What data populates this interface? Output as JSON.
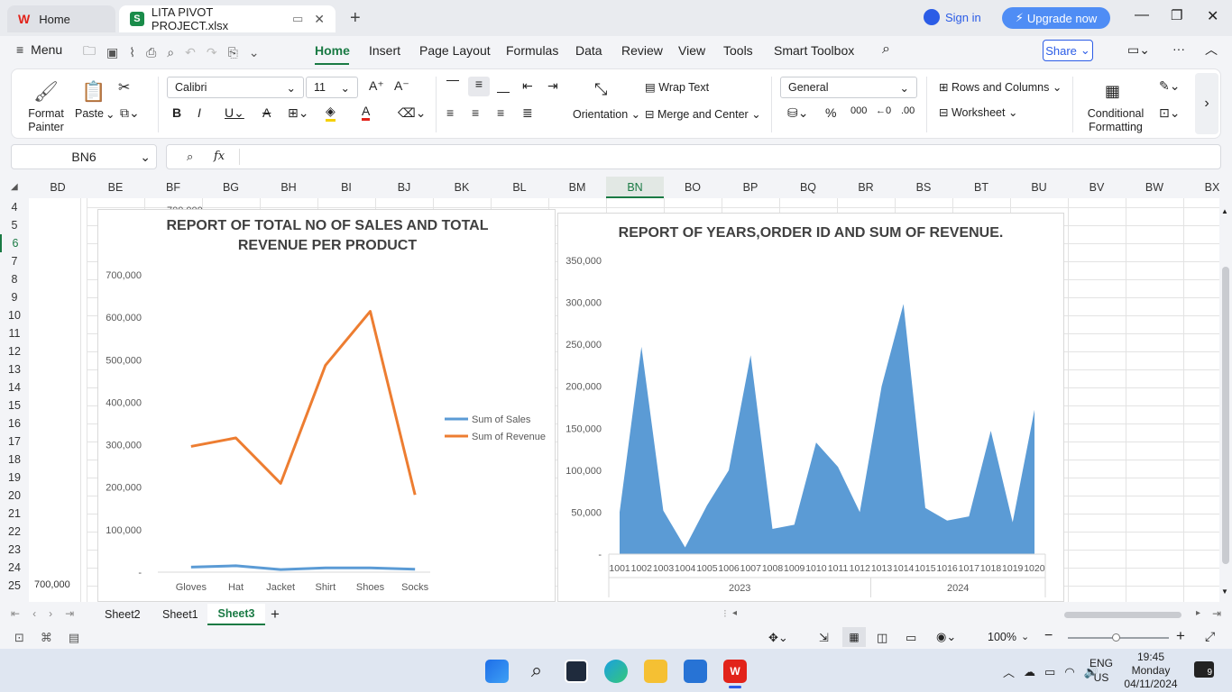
{
  "titlebar": {
    "home_tab": "Home",
    "file_tab": "LITA PIVOT PROJECT.xlsx",
    "sign_in": "Sign in",
    "upgrade": "Upgrade now"
  },
  "menubar": {
    "menu": "Menu",
    "tabs": [
      "Home",
      "Insert",
      "Page Layout",
      "Formulas",
      "Data",
      "Review",
      "View",
      "Tools",
      "Smart Toolbox"
    ],
    "share": "Share"
  },
  "ribbon": {
    "format_painter": "Format Painter",
    "paste": "Paste",
    "font": "Calibri",
    "size": "11",
    "wrap_text": "Wrap Text",
    "merge_center": "Merge and Center",
    "orientation": "Orientation",
    "number_format": "General",
    "rows_columns": "Rows and Columns",
    "worksheet": "Worksheet",
    "conditional_formatting": "Conditional Formatting"
  },
  "formula_bar": {
    "cell_ref": "BN6",
    "fx": "fx",
    "value": ""
  },
  "columns": [
    "BD",
    "BE",
    "BF",
    "BG",
    "BH",
    "BI",
    "BJ",
    "BK",
    "BL",
    "BM",
    "BN",
    "BO",
    "BP",
    "BQ",
    "BR",
    "BS",
    "BT",
    "BU",
    "BV",
    "BW",
    "BX"
  ],
  "selected_column": "BN",
  "rows": [
    "4",
    "5",
    "6",
    "7",
    "8",
    "9",
    "10",
    "11",
    "12",
    "13",
    "14",
    "15",
    "16",
    "17",
    "18",
    "19",
    "20",
    "21",
    "22",
    "23",
    "24",
    "25"
  ],
  "selected_row": "6",
  "cell_bd25": "700,000",
  "cell_bf4": "700,000",
  "chart_data": [
    {
      "type": "line",
      "title": "REPORT OF TOTAL NO OF SALES AND TOTAL REVENUE PER PRODUCT",
      "categories": [
        "Gloves",
        "Hat",
        "Jacket",
        "Shirt",
        "Shoes",
        "Socks"
      ],
      "ylim": [
        0,
        700000
      ],
      "yticks": [
        "700,000",
        "600,000",
        "500,000",
        "400,000",
        "300,000",
        "200,000",
        "100,000",
        "-"
      ],
      "series": [
        {
          "name": "Sum of Sales",
          "color": "#5b9bd5",
          "values": [
            12000,
            15000,
            6000,
            10000,
            10000,
            7000
          ]
        },
        {
          "name": "Sum of Revenue",
          "color": "#ed7d31",
          "values": [
            296000,
            316000,
            209000,
            487000,
            614000,
            182000
          ]
        }
      ],
      "legend": "right",
      "grid": false
    },
    {
      "type": "area",
      "title": "REPORT OF YEARS,ORDER ID AND SUM OF REVENUE.",
      "categories": [
        "1001",
        "1002",
        "1003",
        "1004",
        "1005",
        "1006",
        "1007",
        "1008",
        "1009",
        "1010",
        "1011",
        "1012",
        "1013",
        "1014",
        "1015",
        "1016",
        "1017",
        "1018",
        "1019",
        "1020"
      ],
      "groups": [
        {
          "label": "2023",
          "from": 0,
          "to": 11
        },
        {
          "label": "2024",
          "from": 12,
          "to": 19
        }
      ],
      "ylim": [
        0,
        350000
      ],
      "yticks": [
        "350,000",
        "300,000",
        "250,000",
        "200,000",
        "150,000",
        "100,000",
        "50,000",
        "-"
      ],
      "series": [
        {
          "name": "Sum of Revenue",
          "color": "#5b9bd5",
          "values": [
            50000,
            247000,
            52000,
            8000,
            58000,
            100000,
            237000,
            30000,
            35000,
            133000,
            104000,
            50000,
            200000,
            298000,
            55000,
            40000,
            45000,
            147000,
            38000,
            172000
          ]
        }
      ],
      "legend": "none",
      "grid": false
    }
  ],
  "sheets": [
    "Sheet2",
    "Sheet1",
    "Sheet3"
  ],
  "active_sheet": "Sheet3",
  "status": {
    "zoom": "100%"
  },
  "taskbar": {
    "lang1": "ENG",
    "lang2": "US",
    "time": "19:45",
    "day": "Monday",
    "date": "04/11/2024",
    "notif": "9"
  }
}
